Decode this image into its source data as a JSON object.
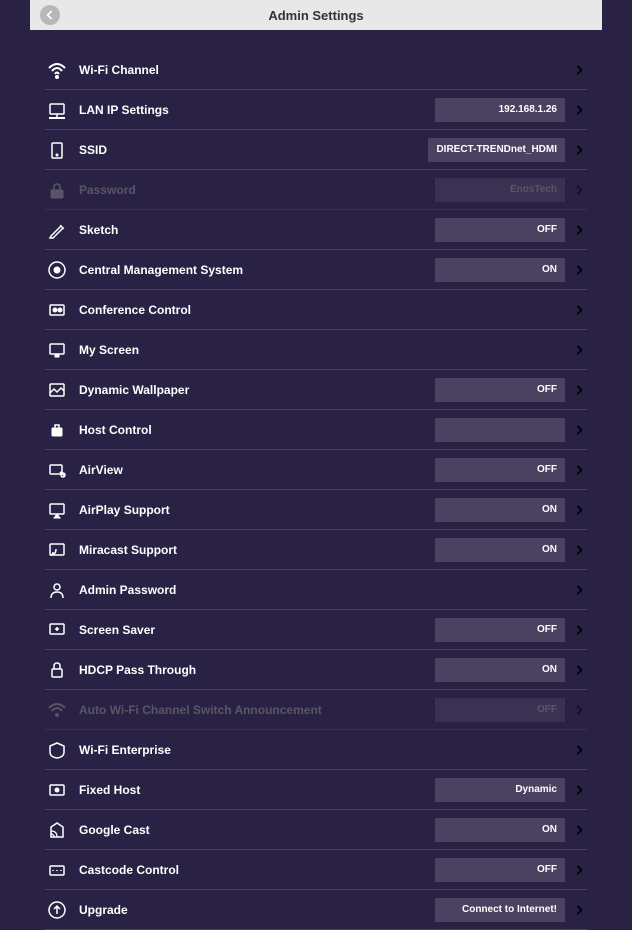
{
  "header": {
    "title": "Admin Settings"
  },
  "settings": [
    {
      "icon": "wifi",
      "label": "Wi-Fi Channel",
      "value": null,
      "disabled": false
    },
    {
      "icon": "lan",
      "label": "LAN IP Settings",
      "value": "192.168.1.26",
      "disabled": false
    },
    {
      "icon": "ssid",
      "label": "SSID",
      "value": "DIRECT-TRENDnet_HDMI",
      "disabled": false
    },
    {
      "icon": "password",
      "label": "Password",
      "value": "EnosTech",
      "disabled": true
    },
    {
      "icon": "sketch",
      "label": "Sketch",
      "value": "OFF",
      "disabled": false
    },
    {
      "icon": "cms",
      "label": "Central Management System",
      "value": "ON",
      "disabled": false
    },
    {
      "icon": "conference",
      "label": "Conference Control",
      "value": null,
      "disabled": false
    },
    {
      "icon": "myscreen",
      "label": "My Screen",
      "value": null,
      "disabled": false
    },
    {
      "icon": "wallpaper",
      "label": "Dynamic Wallpaper",
      "value": "OFF",
      "disabled": false
    },
    {
      "icon": "host",
      "label": "Host Control",
      "value": "",
      "disabled": false
    },
    {
      "icon": "airview",
      "label": "AirView",
      "value": "OFF",
      "disabled": false
    },
    {
      "icon": "airplay",
      "label": "AirPlay Support",
      "value": "ON",
      "disabled": false
    },
    {
      "icon": "miracast",
      "label": "Miracast Support",
      "value": "ON",
      "disabled": false
    },
    {
      "icon": "admin",
      "label": "Admin Password",
      "value": null,
      "disabled": false
    },
    {
      "icon": "screensaver",
      "label": "Screen Saver",
      "value": "OFF",
      "disabled": false
    },
    {
      "icon": "hdcp",
      "label": "HDCP Pass Through",
      "value": "ON",
      "disabled": false
    },
    {
      "icon": "autowifi",
      "label": "Auto Wi-Fi Channel Switch Announcement",
      "value": "OFF",
      "disabled": true
    },
    {
      "icon": "enterprise",
      "label": "Wi-Fi Enterprise",
      "value": null,
      "disabled": false
    },
    {
      "icon": "fixedhost",
      "label": "Fixed Host",
      "value": "Dynamic",
      "disabled": false
    },
    {
      "icon": "googlecast",
      "label": "Google Cast",
      "value": "ON",
      "disabled": false
    },
    {
      "icon": "castcode",
      "label": "Castcode Control",
      "value": "OFF",
      "disabled": false
    },
    {
      "icon": "upgrade",
      "label": "Upgrade",
      "value": "Connect to Internet!",
      "disabled": false
    }
  ]
}
